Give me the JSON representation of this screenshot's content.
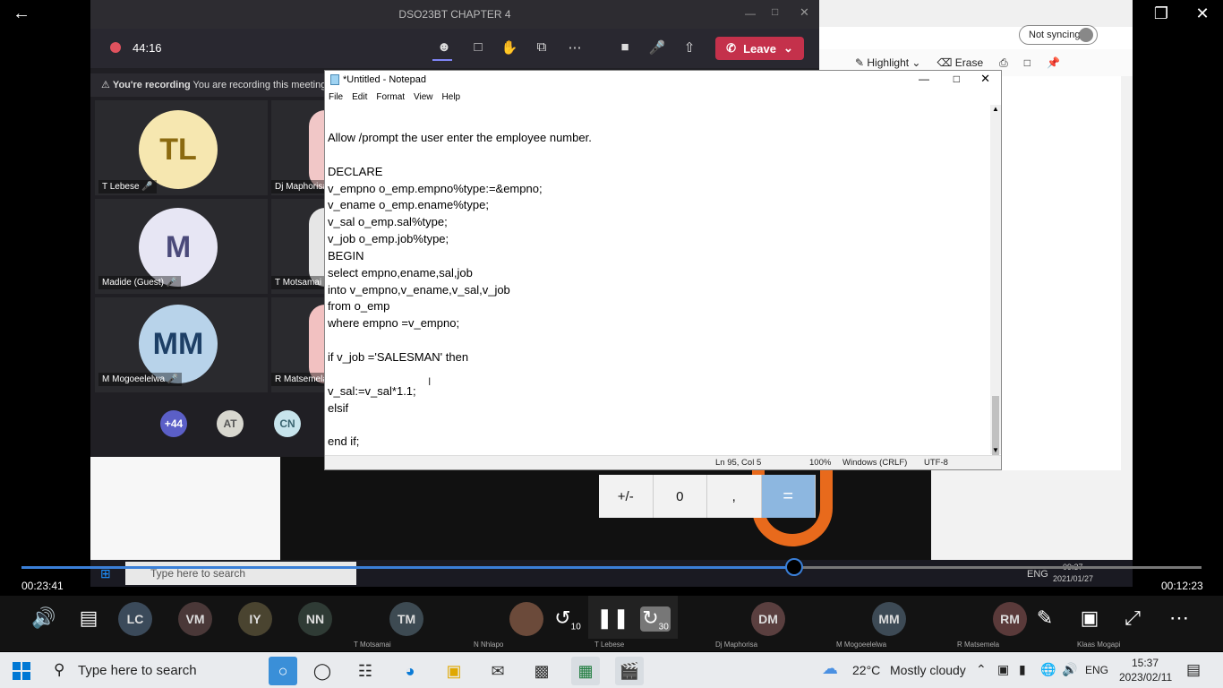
{
  "player": {
    "elapsed": "00:23:41",
    "remaining": "00:12:23"
  },
  "teams": {
    "title": "DSO23BT CHAPTER 4",
    "timer": "44:16",
    "leave_label": "Leave",
    "rec_banner_bold": "You're recording",
    "rec_banner_text": "You are recording this meeting.",
    "tiles": [
      {
        "initials": "TL",
        "name": "T Lebese",
        "bg": "#f6e7b0",
        "fg": "#8b6a10"
      },
      {
        "initials": "M",
        "name": "Madide (Guest)",
        "bg": "#e7e6f4",
        "fg": "#4b4a7a"
      },
      {
        "initials": "MM",
        "name": "M Mogoeelelwa",
        "bg": "#b8d3ea",
        "fg": "#1d3f66"
      }
    ],
    "right_names": [
      "Dj Maphorisa",
      "T Motsamai",
      "R Matsemela"
    ],
    "mini": [
      {
        "label": "+44",
        "bg": "#5b5fc7"
      },
      {
        "label": "AT",
        "bg": "#d8d7cf"
      },
      {
        "label": "CN",
        "bg": "#c7e4ec"
      }
    ]
  },
  "edge": {
    "sync": "Not syncing",
    "highlight": "Highlight",
    "erase": "Erase"
  },
  "notepad": {
    "title": "*Untitled - Notepad",
    "menu": [
      "File",
      "Edit",
      "Format",
      "View",
      "Help"
    ],
    "lines": [
      "Allow /prompt the user enter the employee number.",
      "",
      "DECLARE",
      "v_empno o_emp.empno%type:=&empno;",
      "v_ename o_emp.ename%type;",
      "v_sal o_emp.sal%type;",
      "v_job o_emp.job%type;",
      "BEGIN",
      "select empno,ename,sal,job",
      "into v_empno,v_ename,v_sal,v_job",
      "from o_emp",
      "where empno =v_empno;",
      "",
      "if v_job ='SALESMAN' then",
      "",
      "v_sal:=v_sal*1.1;",
      "elsif",
      "",
      "end if;"
    ],
    "status": {
      "pos": "Ln 95, Col 5",
      "zoom": "100%",
      "eol": "Windows (CRLF)",
      "enc": "UTF-8"
    }
  },
  "calculator": {
    "keys": [
      "+/-",
      "0",
      ",",
      "="
    ]
  },
  "inner_taskbar": {
    "search": "Type here to search",
    "time": "09:37",
    "date": "2021/01/27",
    "lang": "ENG"
  },
  "participants": [
    {
      "initials": "LC",
      "bg": "#3b4a5a"
    },
    {
      "initials": "VM",
      "bg": "#4a3838"
    },
    {
      "initials": "IY",
      "bg": "#4a4430"
    },
    {
      "initials": "NN",
      "bg": "#2f3b35"
    },
    {
      "initials": "TM",
      "bg": "#3d4a52",
      "name": "T Motsamai"
    },
    {
      "initials": "",
      "name": "N Nhlapo"
    },
    {
      "initials": "",
      "name": "T Lebese"
    },
    {
      "initials": "DM",
      "bg": "#5a3f3f",
      "name": "Dj Maphorisa"
    },
    {
      "initials": "MM",
      "bg": "#3d4a55",
      "name": "M Mogoeelelwa"
    },
    {
      "initials": "RM",
      "bg": "#5a3a3a",
      "name": "R Matsemela"
    },
    {
      "initials": "",
      "name": "Klaas Mogapi"
    }
  ],
  "controls": {
    "rewind": "10",
    "forward": "30"
  },
  "taskbar": {
    "search": "Type here to search",
    "weather_temp": "22°C",
    "weather_text": "Mostly cloudy",
    "lang": "ENG",
    "time": "15:37",
    "date": "2023/02/11"
  }
}
